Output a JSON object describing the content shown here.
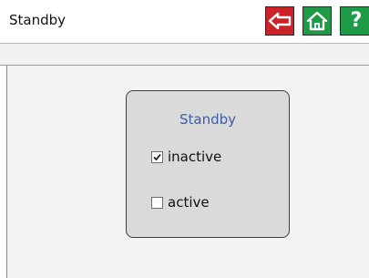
{
  "header": {
    "title": "Standby",
    "help_label": "?"
  },
  "panel": {
    "title": "Standby",
    "options": [
      {
        "label": "inactive",
        "checked": true
      },
      {
        "label": "active",
        "checked": false
      }
    ]
  },
  "colors": {
    "back_button": "#cc2229",
    "home_button": "#1f9b48",
    "help_button": "#1f9b48",
    "panel_title": "#3f5ea8"
  },
  "icons": {
    "back": "arrow-left-icon",
    "home": "home-icon",
    "check": "checkmark-icon"
  }
}
